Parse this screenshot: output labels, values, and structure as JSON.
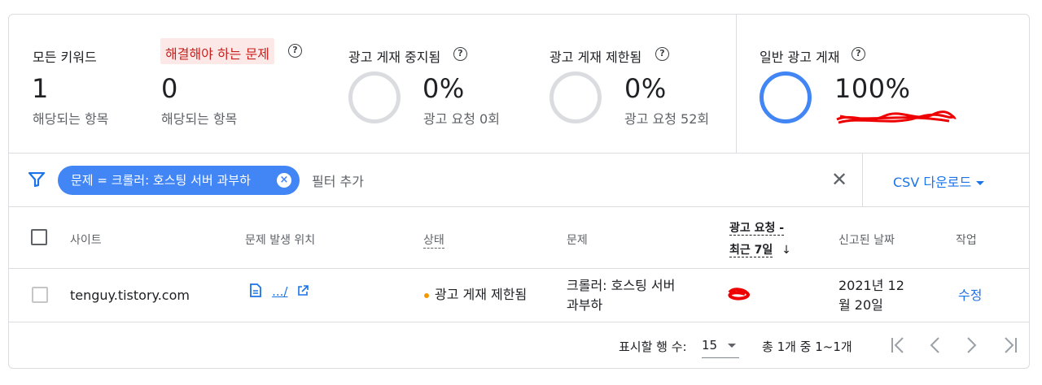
{
  "summary": {
    "all_keywords": {
      "label": "모든 키워드",
      "value": "1",
      "sub": "해당되는 항목"
    },
    "issues": {
      "label": "해결해야 하는 문제",
      "value": "0",
      "sub": "해당되는 항목"
    },
    "suspended": {
      "label": "광고 게재 중지됨",
      "value": "0%",
      "sub": "광고 요청 0회"
    },
    "limited": {
      "label": "광고 게재 제한됨",
      "value": "0%",
      "sub": "광고 요청 52회"
    },
    "normal": {
      "label": "일반 광고 게재",
      "value": "100%"
    }
  },
  "filter": {
    "chip_label": "문제 = 크롤러: 호스팅 서버 과부하",
    "chip_close": "×",
    "add_filter": "필터 추가",
    "clear": "✕",
    "csv_download": "CSV 다운로드"
  },
  "table": {
    "headers": {
      "site": "사이트",
      "location": "문제 발생 위치",
      "status": "상태",
      "issue": "문제",
      "requests_line1": "광고 요청 -",
      "requests_line2": "최근 7일",
      "sort_arrow": "↓",
      "reported_date": "신고된 날짜",
      "action": "작업"
    },
    "rows": [
      {
        "site": "tenguy.tistory.com",
        "location": ".../",
        "status": "광고 게재 제한됨",
        "issue_line1": "크롤러: 호스팅 서버",
        "issue_line2": "과부하",
        "date_line1": "2021년 12",
        "date_line2": "월 20일",
        "action": "수정"
      }
    ]
  },
  "pagination": {
    "rows_label": "표시할 행 수:",
    "rows_value": "15",
    "range": "총 1개 중 1~1개",
    "first": "|〈",
    "prev": "〈",
    "next": "〉",
    "last": "〉|"
  },
  "colors": {
    "accent": "#1a73e8",
    "chip": "#4285f4",
    "warning_dot": "#f29900",
    "issues_bg": "#fce8e6",
    "issues_text": "#c5221f"
  }
}
